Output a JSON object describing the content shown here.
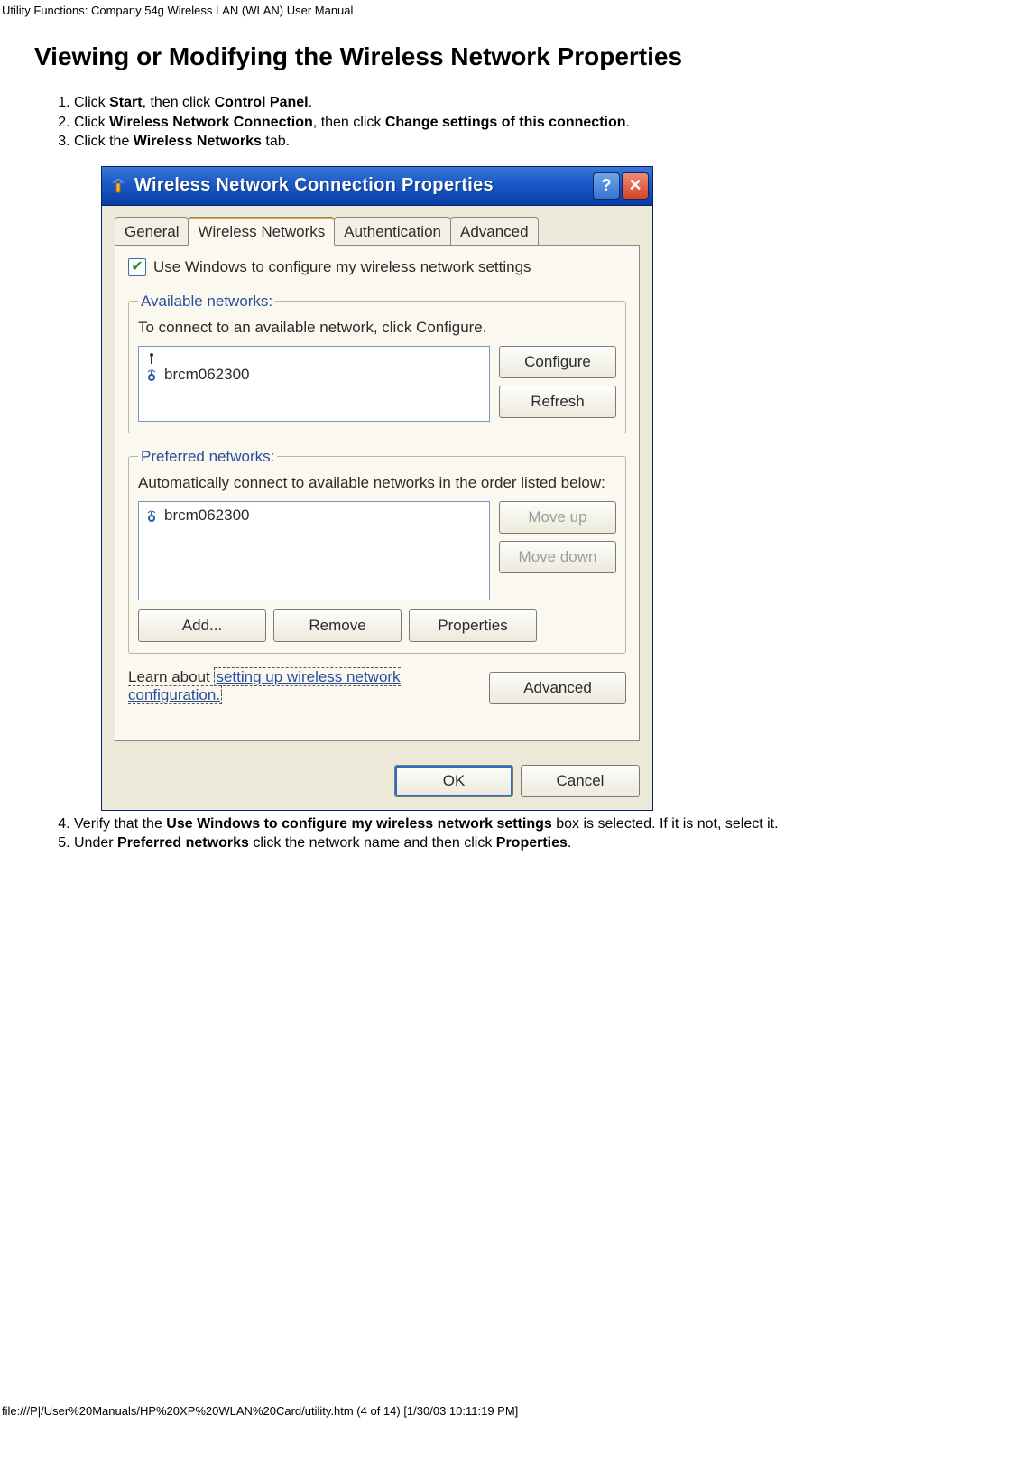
{
  "page_header": "Utility Functions: Company 54g Wireless LAN (WLAN) User Manual",
  "section_title": "Viewing or Modifying the Wireless Network Properties",
  "steps": {
    "s1_a": "Click ",
    "s1_b": "Start",
    "s1_c": ", then click ",
    "s1_d": "Control Panel",
    "s1_e": ".",
    "s2_a": "Click ",
    "s2_b": "Wireless Network Connection",
    "s2_c": ", then click ",
    "s2_d": "Change settings of this connection",
    "s2_e": ".",
    "s3_a": "Click the ",
    "s3_b": "Wireless Networks",
    "s3_c": " tab.",
    "s4_a": "Verify that the ",
    "s4_b": "Use Windows to configure my wireless network settings",
    "s4_c": " box is selected. If it is not, select it.",
    "s5_a": "Under ",
    "s5_b": "Preferred networks",
    "s5_c": " click the network name and then click ",
    "s5_d": "Properties",
    "s5_e": "."
  },
  "dialog": {
    "title": "Wireless Network Connection Properties",
    "help_symbol": "?",
    "close_symbol": "✕",
    "tabs": [
      "General",
      "Wireless Networks",
      "Authentication",
      "Advanced"
    ],
    "checkbox_label": "Use Windows to configure my wireless network settings",
    "available": {
      "legend": "Available networks:",
      "text": "To connect to an available network, click Configure.",
      "item_tower": "i",
      "items": [
        "brcm062300"
      ],
      "buttons": {
        "configure": "Configure",
        "refresh": "Refresh"
      }
    },
    "preferred": {
      "legend": "Preferred networks:",
      "text": "Automatically connect to available networks in the order listed below:",
      "items": [
        "brcm062300"
      ],
      "buttons": {
        "moveup": "Move up",
        "movedown": "Move down",
        "add": "Add...",
        "remove": "Remove",
        "properties": "Properties"
      }
    },
    "learn": {
      "prefix": "Learn about ",
      "link": "setting up wireless network configuration.",
      "advanced": "Advanced"
    },
    "footer": {
      "ok": "OK",
      "cancel": "Cancel"
    }
  },
  "page_footer": "file:///P|/User%20Manuals/HP%20XP%20WLAN%20Card/utility.htm (4 of 14) [1/30/03 10:11:19 PM]"
}
